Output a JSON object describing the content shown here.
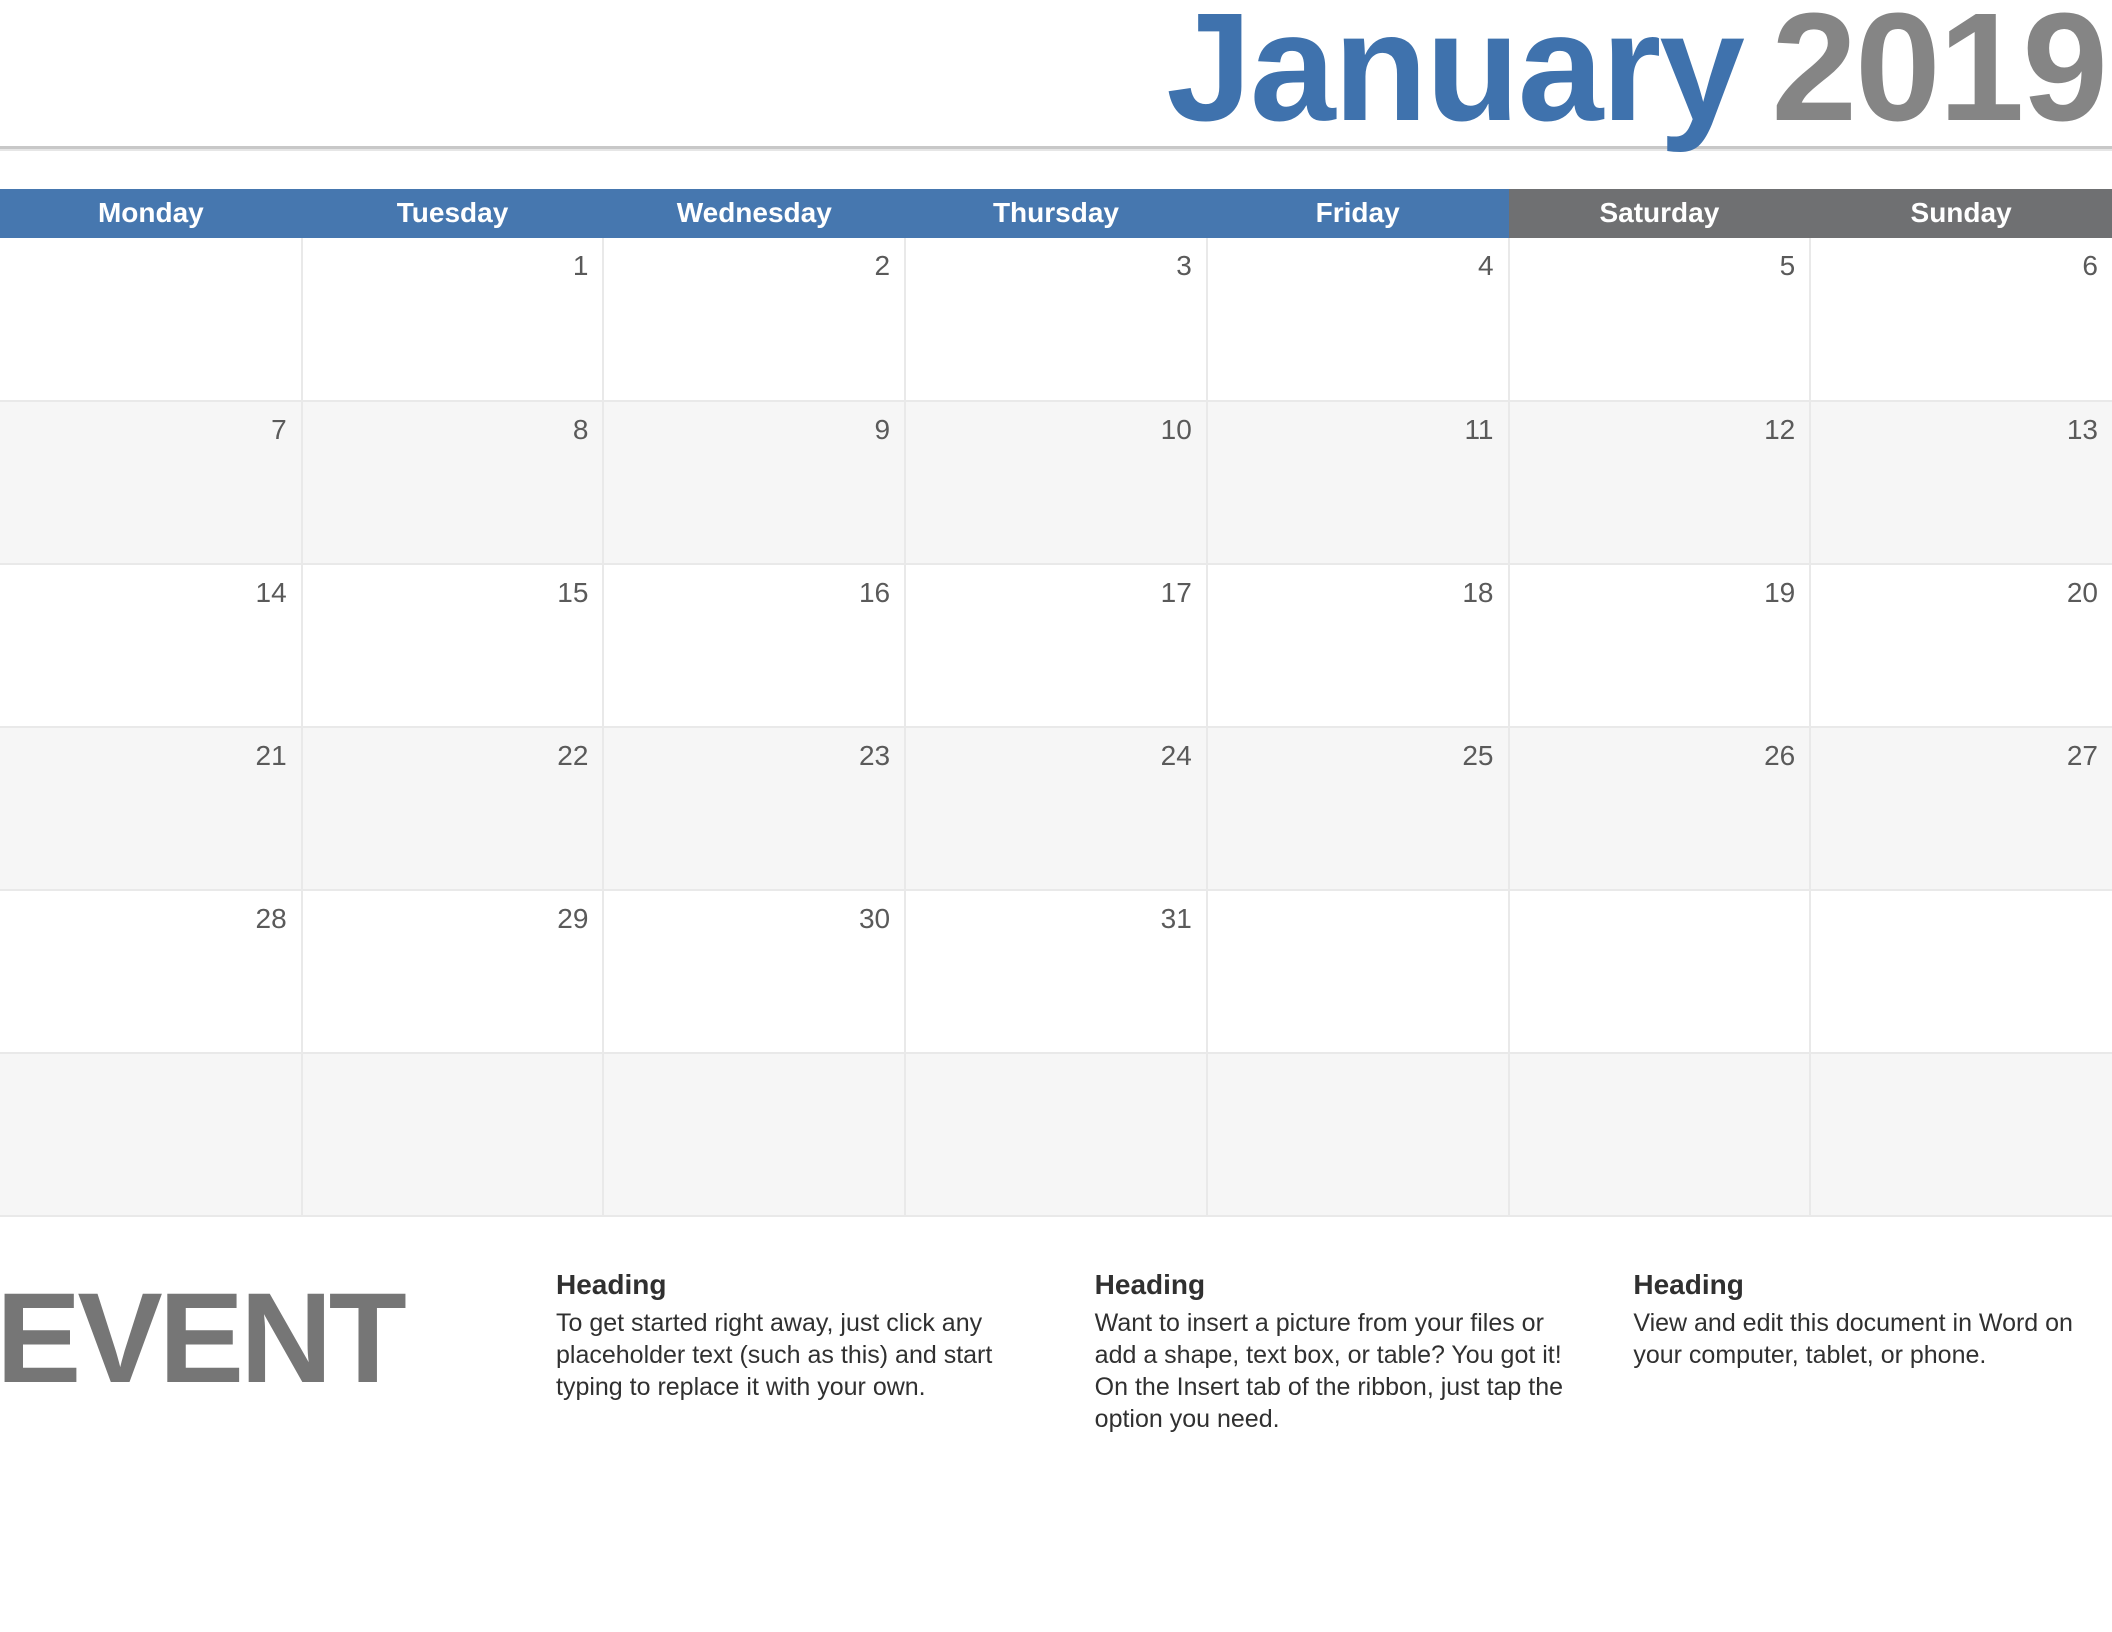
{
  "title": {
    "month": "January",
    "year": "2019"
  },
  "days": [
    "Monday",
    "Tuesday",
    "Wednesday",
    "Thursday",
    "Friday",
    "Saturday",
    "Sunday"
  ],
  "weeks": [
    [
      "",
      "1",
      "2",
      "3",
      "4",
      "5",
      "6"
    ],
    [
      "7",
      "8",
      "9",
      "10",
      "11",
      "12",
      "13"
    ],
    [
      "14",
      "15",
      "16",
      "17",
      "18",
      "19",
      "20"
    ],
    [
      "21",
      "22",
      "23",
      "24",
      "25",
      "26",
      "27"
    ],
    [
      "28",
      "29",
      "30",
      "31",
      "",
      "",
      ""
    ],
    [
      "",
      "",
      "",
      "",
      "",
      "",
      ""
    ]
  ],
  "event_label": "EVENT",
  "notes": [
    {
      "heading": "Heading",
      "body": "To get started right away, just click any placeholder text (such as this) and start typing to replace it with your own."
    },
    {
      "heading": "Heading",
      "body": "Want to insert a picture from your files or add a shape, text box, or table? You got it! On the Insert tab of the ribbon, just tap the option you need."
    },
    {
      "heading": "Heading",
      "body": "View and edit this document in Word on your computer, tablet, or phone."
    }
  ]
}
